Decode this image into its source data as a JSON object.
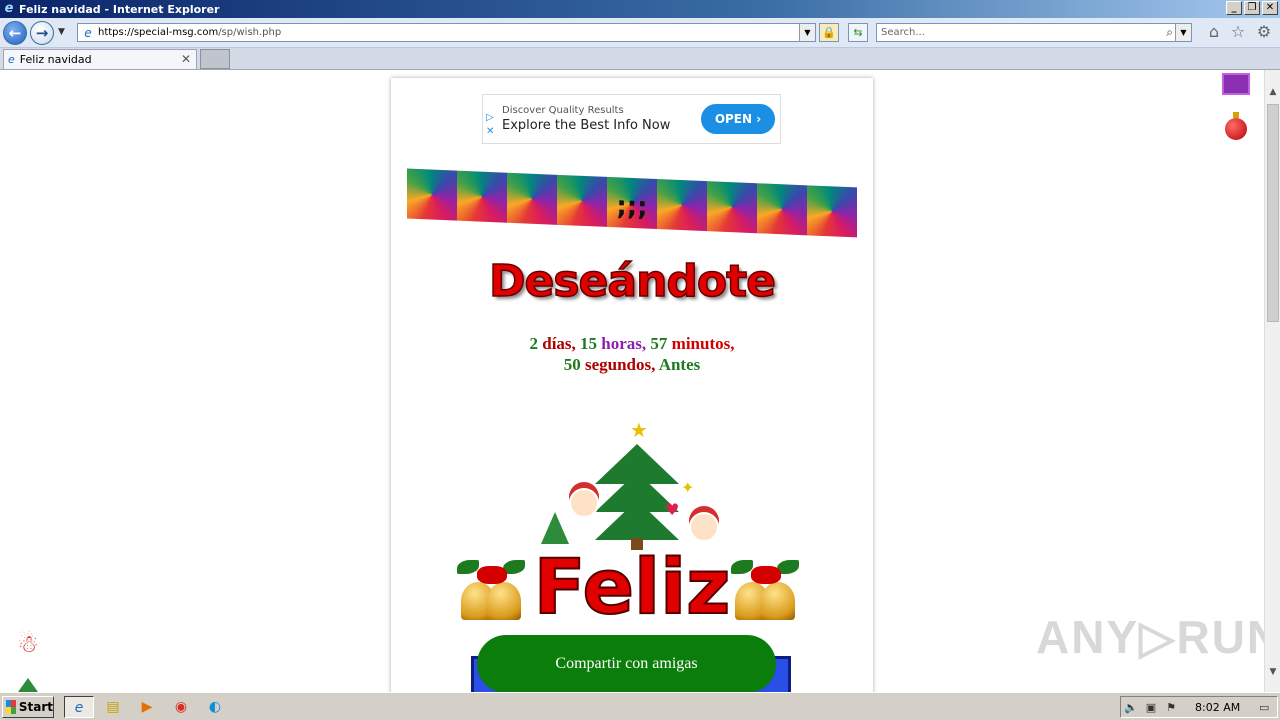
{
  "window": {
    "title": "Feliz navidad - Internet Explorer",
    "controls": [
      "_",
      "❐",
      "✕"
    ]
  },
  "nav": {
    "url_host": "https://special-msg.com",
    "url_path": "/sp/wish.php",
    "search_placeholder": "Search..."
  },
  "tab": {
    "label": "Feliz navidad"
  },
  "ad": {
    "small": "Discover Quality Results",
    "big": "Explore the Best Info Now",
    "open_label": "OPEN ›"
  },
  "banner": {
    "glyph": ";;;"
  },
  "page": {
    "heading": "Deseándote",
    "countdown": {
      "days_num": "2",
      "days_word": "días,",
      "hours_num": "15",
      "hours_word": "horas,",
      "minutes_num": "57",
      "minutes_word": "minutos,",
      "seconds_num": "50",
      "seconds_word": "segundos,",
      "tail": "Antes"
    },
    "feliz": "Feliz",
    "share_label": "Compartir con amigas"
  },
  "watermark": "ANY▷RUN",
  "taskbar": {
    "start_label": "Start",
    "clock": "8:02 AM"
  },
  "colors": {
    "share_button": "#0a7d0a",
    "heading_red": "#e00000",
    "ad_blue": "#1a8fe3"
  }
}
